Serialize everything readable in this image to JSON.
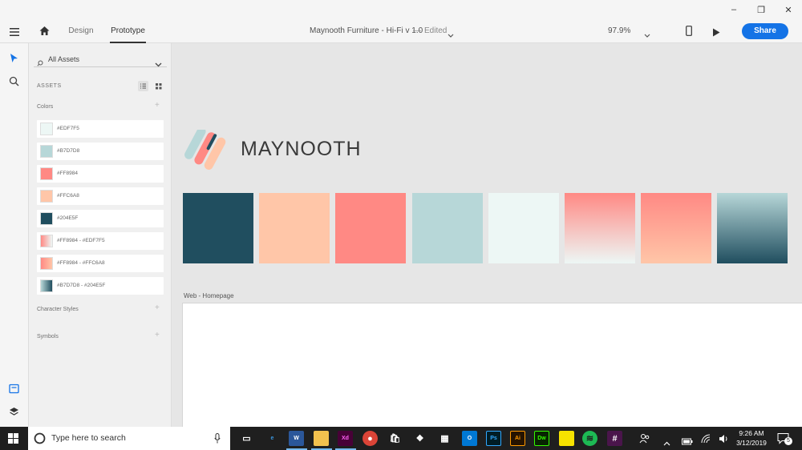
{
  "window": {
    "minimize_label": "–",
    "restore_label": "❐",
    "close_label": "✕"
  },
  "toolbar": {
    "tabs": [
      {
        "label": "Design"
      },
      {
        "label": "Prototype"
      }
    ],
    "document_title": "Maynooth Furniture - Hi-Fi v 1.0",
    "separator": "—",
    "status": "Edited",
    "zoom": "97.9%",
    "share_label": "Share"
  },
  "assets": {
    "filter_label": "All Assets",
    "header": "ASSETS",
    "sections": {
      "colors": "Colors",
      "character_styles": "Character Styles",
      "symbols": "Symbols"
    },
    "colors": [
      {
        "label": "#EDF7F5",
        "color": "#EDF7F5"
      },
      {
        "label": "#B7D7D8",
        "color": "#B7D7D8"
      },
      {
        "label": "#FF8984",
        "color": "#FF8984"
      },
      {
        "label": "#FFC6A8",
        "color": "#FFC6A8"
      },
      {
        "label": "#204E5F",
        "color": "#204E5F"
      },
      {
        "label": "#FF8984 - #EDF7F5",
        "gradient": [
          "#FF8984",
          "#EDF7F5"
        ]
      },
      {
        "label": "#FF8984 - #FFC6A8",
        "gradient": [
          "#FF8984",
          "#FFC6A8"
        ]
      },
      {
        "label": "#B7D7D8 - #204E5F",
        "gradient": [
          "#B7D7D8",
          "#204E5F"
        ]
      }
    ]
  },
  "canvas": {
    "logo_text": "MAYNOOTH",
    "artboard_label": "Web - Homepage",
    "tiles": [
      {
        "color": "#204E5F"
      },
      {
        "color": "#FFC6A8"
      },
      {
        "color": "#FF8984"
      },
      {
        "color": "#B7D7D8"
      },
      {
        "color": "#EDF7F5"
      },
      {
        "gradient": [
          "#FF8984",
          "#EDF7F5"
        ]
      },
      {
        "gradient": [
          "#FF8984",
          "#FFC6A8"
        ]
      },
      {
        "gradient": [
          "#B7D7D8",
          "#204E5F"
        ]
      }
    ]
  },
  "taskbar": {
    "search_placeholder": "Type here to search",
    "time": "9:26 AM",
    "date": "3/12/2019",
    "notification_count": "5",
    "apps": [
      {
        "name": "task-view"
      },
      {
        "name": "edge",
        "label": "e"
      },
      {
        "name": "word",
        "label": "W"
      },
      {
        "name": "file-explorer"
      },
      {
        "name": "xd",
        "label": "Xd"
      },
      {
        "name": "chrome"
      },
      {
        "name": "store"
      },
      {
        "name": "dropbox"
      },
      {
        "name": "calendar"
      },
      {
        "name": "outlook",
        "label": "O"
      },
      {
        "name": "photoshop",
        "label": "Ps"
      },
      {
        "name": "illustrator",
        "label": "Ai"
      },
      {
        "name": "dreamweaver",
        "label": "Dw"
      },
      {
        "name": "sticky-notes"
      },
      {
        "name": "spotify"
      },
      {
        "name": "slack"
      }
    ]
  },
  "colors": {
    "accent": "#1473e6",
    "taskbar": "#1f1f1f"
  }
}
